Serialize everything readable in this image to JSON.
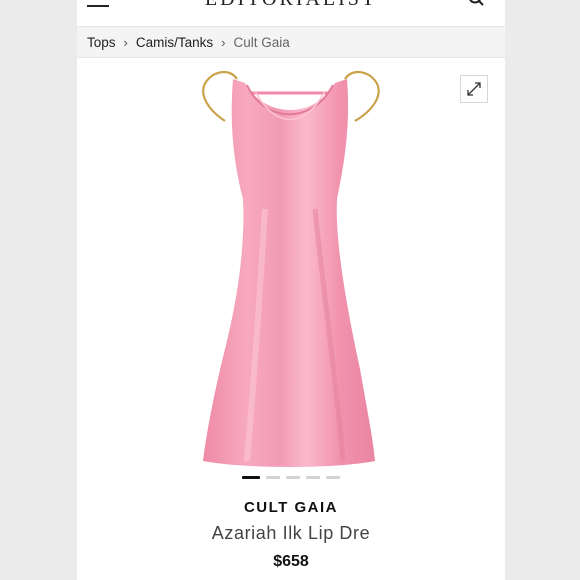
{
  "header": {
    "logo_text": "EDITORIALIST"
  },
  "breadcrumb": {
    "items": [
      "Tops",
      "Camis/Tanks",
      "Cult Gaia"
    ],
    "separator": "›"
  },
  "product": {
    "brand": "CULT GAIA",
    "name": "Azariah Ilk Lip Dre",
    "price": "$658",
    "image_color": "#f49bb4"
  },
  "carousel": {
    "total_slides": 5,
    "active_index": 0
  },
  "icons": {
    "menu": "hamburger-menu-icon",
    "search": "search-icon",
    "expand": "expand-icon"
  }
}
